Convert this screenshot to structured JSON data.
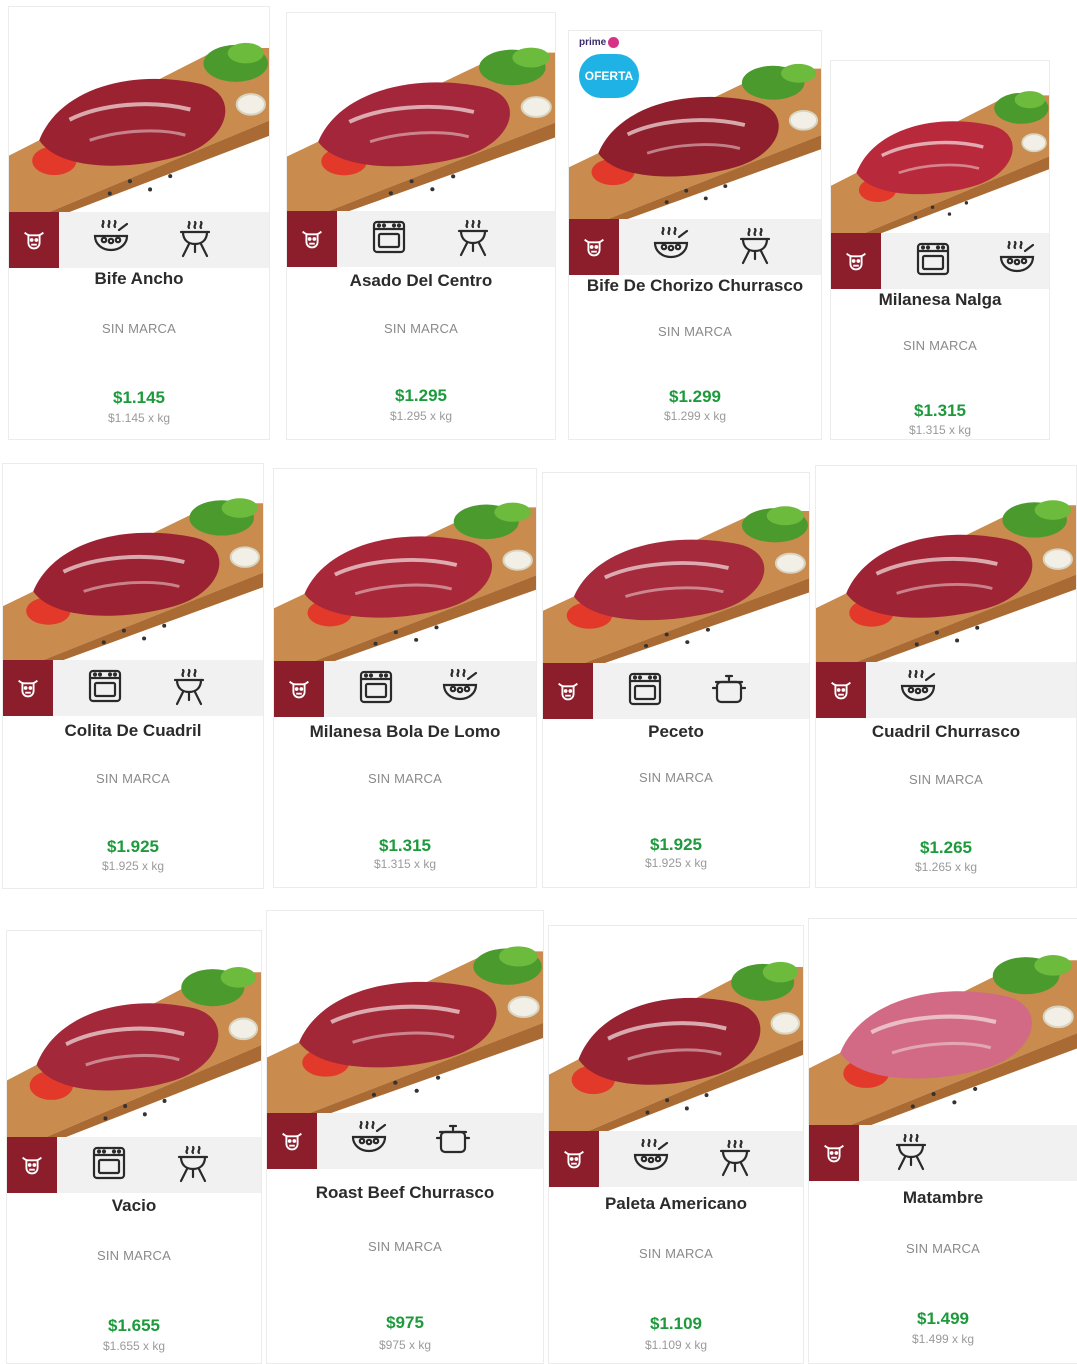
{
  "colors": {
    "badge": "#8c1d2b",
    "price": "#1d9a3c",
    "oferta": "#1fb3e5",
    "icon_stroke": "#2a2a2a"
  },
  "products": [
    {
      "name": "Bife Ancho",
      "brand": "SIN MARCA",
      "price": "$1.145",
      "unit_price": "$1.145 x kg",
      "icons": [
        "sartén-icon",
        "grill-icon"
      ],
      "meat_color": "#9b2230",
      "badge_icon": "cow-icon"
    },
    {
      "name": "Asado Del Centro",
      "brand": "SIN MARCA",
      "price": "$1.295",
      "unit_price": "$1.295 x kg",
      "icons": [
        "oven-icon",
        "grill-icon"
      ],
      "meat_color": "#a3263a",
      "badge_icon": "cow-icon"
    },
    {
      "name": "Bife De Chorizo Churrasco",
      "brand": "SIN MARCA",
      "price": "$1.299",
      "unit_price": "$1.299 x kg",
      "icons": [
        "sartén-icon",
        "grill-icon"
      ],
      "meat_color": "#8f1f2c",
      "badge_icon": "cow-icon",
      "promo": {
        "prime": "prime",
        "badge": "OFERTA"
      }
    },
    {
      "name": "Milanesa Nalga",
      "brand": "SIN MARCA",
      "price": "$1.315",
      "unit_price": "$1.315 x kg",
      "icons": [
        "oven-icon",
        "sartén-icon"
      ],
      "meat_color": "#b8293c",
      "badge_icon": "cow-icon"
    },
    {
      "name": "Colita De Cuadril",
      "brand": "SIN MARCA",
      "price": "$1.925",
      "unit_price": "$1.925 x kg",
      "icons": [
        "oven-icon",
        "grill-icon"
      ],
      "meat_color": "#9a2232",
      "badge_icon": "cow-icon"
    },
    {
      "name": "Milanesa Bola De Lomo",
      "brand": "SIN MARCA",
      "price": "$1.315",
      "unit_price": "$1.315 x kg",
      "icons": [
        "oven-icon",
        "sartén-icon"
      ],
      "meat_color": "#a8283a",
      "badge_icon": "cow-icon"
    },
    {
      "name": "Peceto",
      "brand": "SIN MARCA",
      "price": "$1.925",
      "unit_price": "$1.925 x kg",
      "icons": [
        "oven-icon",
        "pot-icon"
      ],
      "meat_color": "#a52a3c",
      "badge_icon": "cow-icon"
    },
    {
      "name": "Cuadril Churrasco",
      "brand": "SIN MARCA",
      "price": "$1.265",
      "unit_price": "$1.265 x kg",
      "icons": [
        "sartén-icon"
      ],
      "meat_color": "#9e2335",
      "badge_icon": "cow-icon"
    },
    {
      "name": "Vacio",
      "brand": "SIN MARCA",
      "price": "$1.655",
      "unit_price": "$1.655 x kg",
      "icons": [
        "oven-icon",
        "grill-icon"
      ],
      "meat_color": "#a3283a",
      "badge_icon": "cow-icon"
    },
    {
      "name": "Roast Beef Churrasco",
      "brand": "SIN MARCA",
      "price": "$975",
      "unit_price": "$975 x kg",
      "icons": [
        "sartén-icon",
        "pot-icon"
      ],
      "meat_color": "#a22838",
      "badge_icon": "cow-icon"
    },
    {
      "name": "Paleta Americano",
      "brand": "SIN MARCA",
      "price": "$1.109",
      "unit_price": "$1.109 x kg",
      "icons": [
        "sartén-icon",
        "grill-icon"
      ],
      "meat_color": "#962232",
      "badge_icon": "cow-icon"
    },
    {
      "name": "Matambre",
      "brand": "SIN MARCA",
      "price": "$1.499",
      "unit_price": "$1.499 x kg",
      "icons": [
        "grill-icon"
      ],
      "meat_color": "#d26a86",
      "badge_icon": "cow-icon"
    }
  ]
}
